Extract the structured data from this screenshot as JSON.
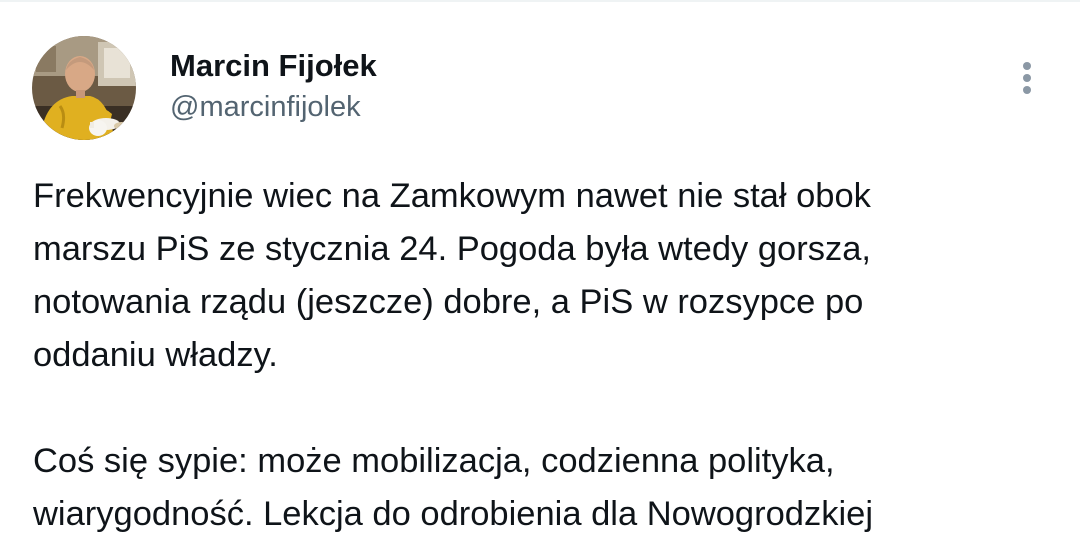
{
  "author": {
    "display_name": "Marcin Fijołek",
    "handle": "@marcinfijolek"
  },
  "tweet": {
    "paragraph_1_lines": [
      "Frekwencyjnie wiec na Zamkowym nawet nie stał obok",
      "marszu PiS ze stycznia 24. Pogoda była wtedy gorsza,",
      "notowania rządu (jeszcze) dobre, a PiS w rozsypce po",
      "oddaniu władzy."
    ],
    "paragraph_2_lines": [
      "Coś się sypie: może mobilizacja, codzienna polityka,",
      "wiarygodność. Lekcja do odrobienia dla Nowogrodzkiej"
    ]
  },
  "icons": {
    "more": "more-vertical-icon"
  },
  "colors": {
    "text_primary": "#0f1419",
    "text_secondary": "#536471",
    "icon_gray": "#8b98a5",
    "divider": "#eff3f4"
  }
}
